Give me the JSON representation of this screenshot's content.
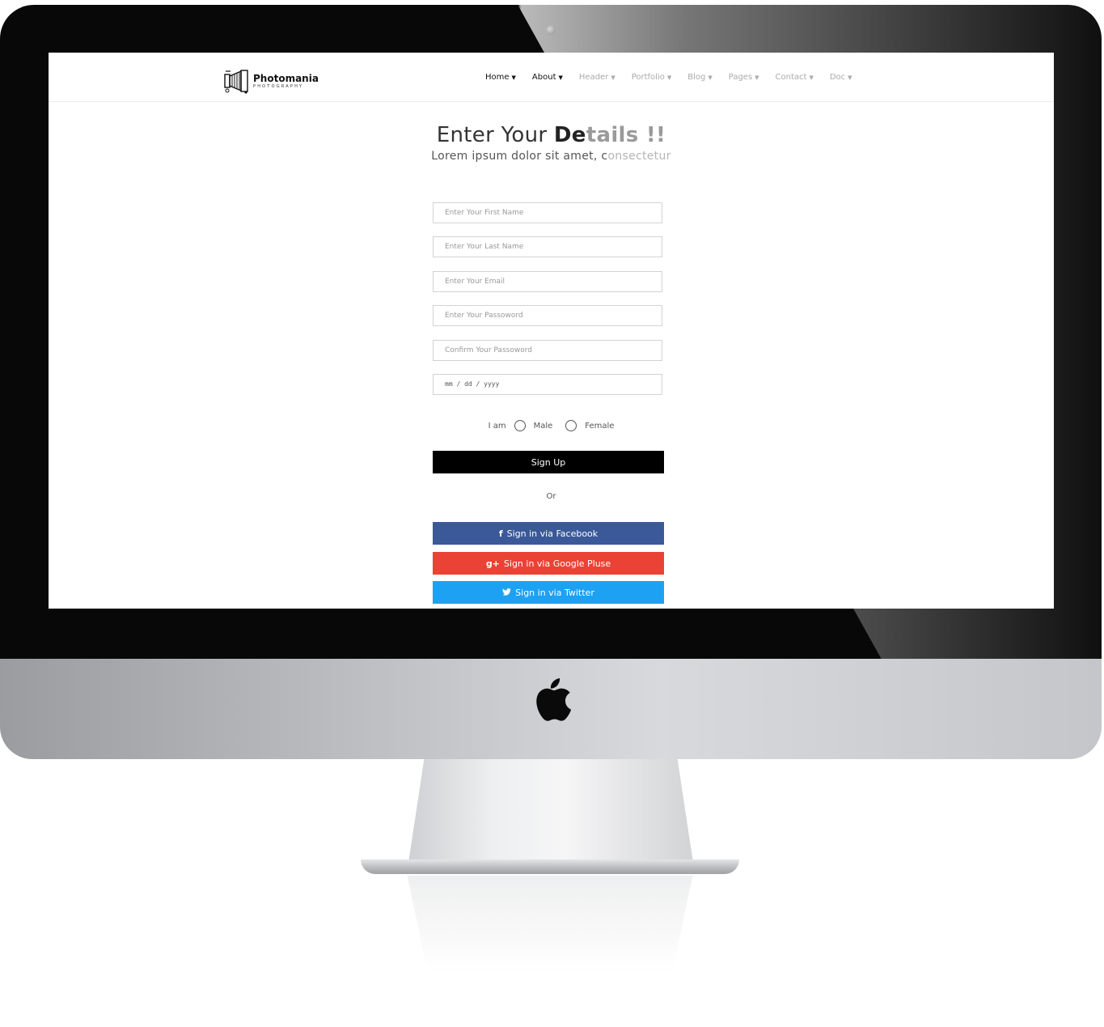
{
  "brand": {
    "name": "Photomania",
    "tagline": "PHOTOGRAPHY"
  },
  "nav": [
    {
      "label": "Home"
    },
    {
      "label": "About"
    },
    {
      "label": "Header"
    },
    {
      "label": "Portfolio"
    },
    {
      "label": "Blog"
    },
    {
      "label": "Pages"
    },
    {
      "label": "Contact"
    },
    {
      "label": "Doc"
    }
  ],
  "hero": {
    "title_plain": "Enter Your ",
    "title_bold": "De",
    "title_faded": "tails !!",
    "subtitle_plain": "Lorem ipsum dolor sit amet, c",
    "subtitle_faded": "onsectetur"
  },
  "form": {
    "first_name_placeholder": "Enter Your First Name",
    "last_name_placeholder": "Enter Your Last Name",
    "email_placeholder": "Enter Your Email",
    "password_placeholder": "Enter Your Passoword",
    "confirm_placeholder": "Confirm Your Passoword",
    "date_text": "mm / dd / yyyy",
    "gender_label": "I am",
    "male_label": "Male",
    "female_label": "Female",
    "signup_label": "Sign Up",
    "or_label": "Or"
  },
  "social": {
    "facebook_label": "Sign in via Facebook",
    "google_label": "Sign in via Google Pluse",
    "twitter_label": "Sign in via Twitter"
  },
  "colors": {
    "facebook": "#3b5998",
    "google": "#ea4335",
    "twitter": "#1da1f2",
    "signup": "#000000"
  },
  "icons": {
    "facebook": "f",
    "google": "g+",
    "twitter": "🐦"
  }
}
